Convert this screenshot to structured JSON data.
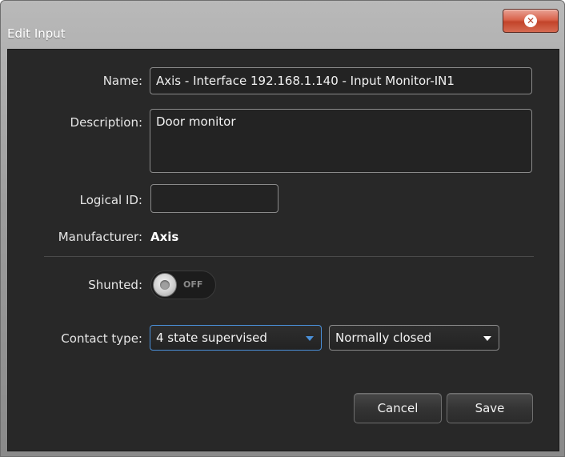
{
  "window": {
    "title": "Edit Input",
    "close_icon": "close-icon"
  },
  "form": {
    "name_label": "Name:",
    "name_value": "Axis - Interface 192.168.1.140 - Input Monitor-IN1",
    "description_label": "Description:",
    "description_value": "Door monitor",
    "logical_id_label": "Logical ID:",
    "logical_id_value": "",
    "manufacturer_label": "Manufacturer:",
    "manufacturer_value": "Axis",
    "shunted_label": "Shunted:",
    "shunted_state": "OFF",
    "contact_type_label": "Contact type:",
    "contact_type_value": "4 state supervised",
    "contact_mode_value": "Normally closed"
  },
  "buttons": {
    "cancel_label": "Cancel",
    "save_label": "Save"
  },
  "colors": {
    "panel_background": "#282828",
    "accent_blue": "#4a90d9",
    "close_button_red": "#d9644c"
  }
}
